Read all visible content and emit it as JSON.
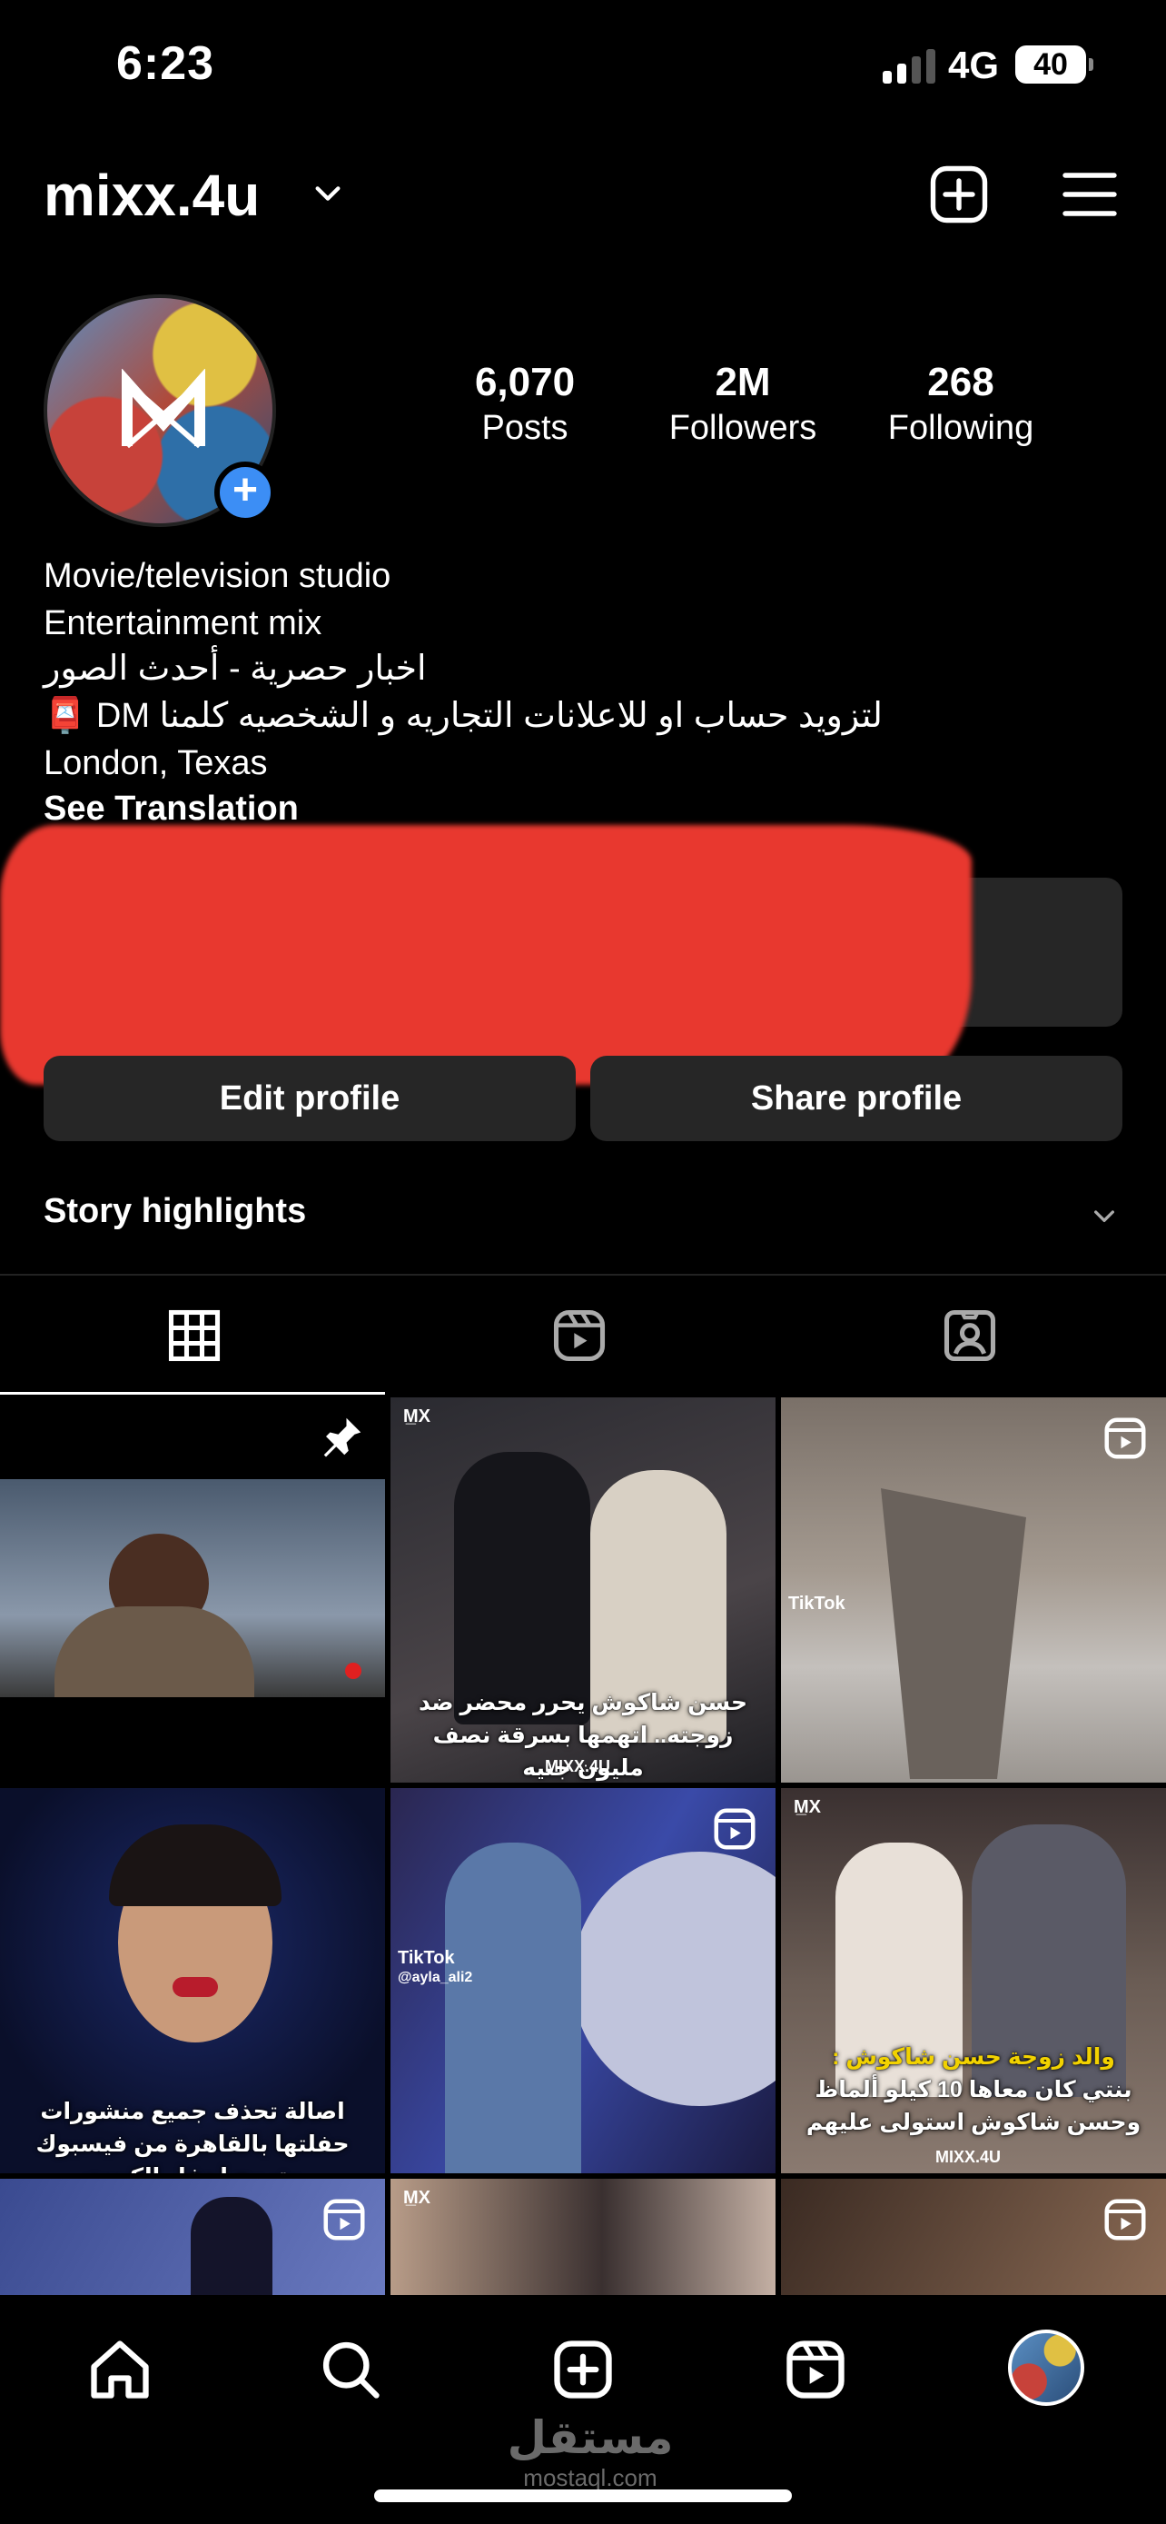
{
  "status_bar": {
    "time": "6:23",
    "network": "4G",
    "battery": "40"
  },
  "header": {
    "username": "mixx.4u",
    "icons": [
      "add-post-icon",
      "menu-icon",
      "chevron-down-icon"
    ]
  },
  "profile": {
    "avatar_text": "M I X",
    "stats": [
      {
        "value": "6,070",
        "label": "Posts"
      },
      {
        "value": "2M",
        "label": "Followers"
      },
      {
        "value": "268",
        "label": "Following"
      }
    ],
    "bio": {
      "category": "Movie/television studio",
      "line1": "Entertainment mix",
      "line2": "اخبار حصرية - أحدث الصور",
      "line3": "📮 DM لتزويد حساب او للاعلانات التجاريه و الشخصيه كلمنا",
      "location": "London, Texas",
      "translation_link": "See Translation"
    },
    "buttons": {
      "edit": "Edit profile",
      "share": "Share profile"
    },
    "highlights_label": "Story highlights"
  },
  "tabs": [
    "posts-grid-tab",
    "reels-tab",
    "tagged-tab"
  ],
  "grid": {
    "tiles": [
      {
        "caption": "",
        "pinned": true,
        "reel": false
      },
      {
        "caption": "حسن شاكوش يحرر محضر ضد زوجته.. اتهمها بسرقة نصف مليون جنيه",
        "watermark": "MIXX.4U",
        "pinned": false,
        "reel": false
      },
      {
        "caption": "",
        "watermark": "TikTok",
        "reel": true
      },
      {
        "caption": "اصالة تحذف جميع منشورات حفلتها بالقاهرة من فيسبوك وتروج لحفل الكويت",
        "reel": false
      },
      {
        "caption": "",
        "watermark": "TikTok",
        "handle": "@ayla_ali2",
        "reel": true
      },
      {
        "caption_highlight": "والد زوجة حسن شاكوش :",
        "caption": "بنتي كان معاها 10 كيلو ألماظ وحسن شاكوش استولى عليهم",
        "watermark": "MIXX.4U",
        "reel": false
      },
      {
        "caption": "",
        "reel": true
      },
      {
        "caption": "",
        "reel": false
      },
      {
        "caption": "",
        "reel": true
      }
    ]
  },
  "bottom_nav": [
    "home-icon",
    "search-icon",
    "create-icon",
    "reels-icon",
    "profile-avatar"
  ],
  "watermark": {
    "arabic": "مستقل",
    "latin": "mostaql.com"
  },
  "colors": {
    "background": "#000000",
    "button": "#262626",
    "accent_blue": "#3c8ef5",
    "redaction": "#e8382f"
  }
}
